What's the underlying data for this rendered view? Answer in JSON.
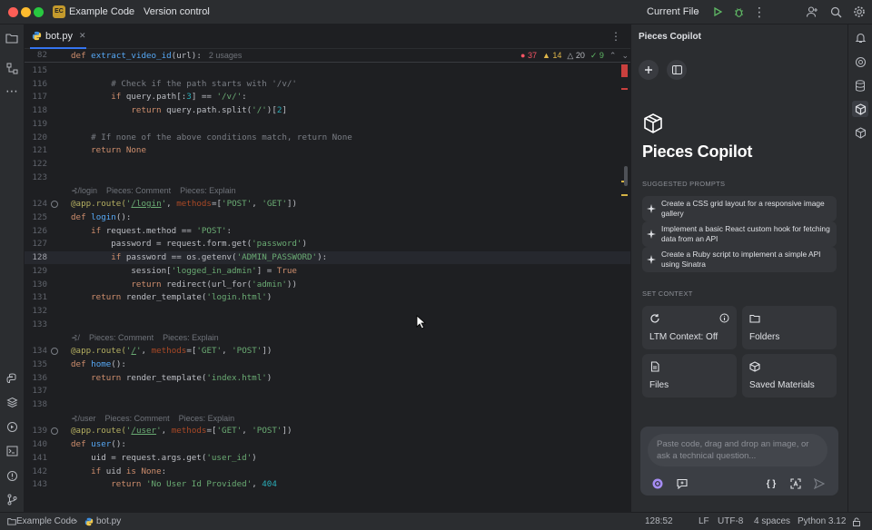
{
  "titlebar": {
    "project_badge": "EC",
    "project_name": "Example Code",
    "vcs_label": "Version control",
    "run_config": "Current File"
  },
  "editor": {
    "tab_name": "bot.py",
    "sticky_line_number": "82",
    "sticky_def": "def",
    "sticky_fn": "extract_video_id",
    "sticky_args": "(url):",
    "sticky_usages": "2 usages",
    "inspections": {
      "errors": "37",
      "warnings": "14",
      "weak": "20",
      "ok": "9"
    },
    "lines": [
      {
        "n": "115",
        "html": ""
      },
      {
        "n": "116",
        "html": "        <span class='cm'># Check if the path starts with '/v/'</span>"
      },
      {
        "n": "117",
        "html": "        <span class='kw'>if</span> query.path[:<span class='num'>3</span>] == <span class='str'>'/v/'</span>:"
      },
      {
        "n": "118",
        "html": "            <span class='kw'>return</span> query.path.split(<span class='str'>'/'</span>)[<span class='num'>2</span>]"
      },
      {
        "n": "119",
        "html": ""
      },
      {
        "n": "120",
        "html": "    <span class='cm'># If none of the above conditions match, return None</span>"
      },
      {
        "n": "121",
        "html": "    <span class='kw'>return None</span>"
      },
      {
        "n": "122",
        "html": ""
      },
      {
        "n": "123",
        "html": ""
      },
      {
        "hint": "⊰/login    Pieces: Comment    Pieces: Explain"
      },
      {
        "n": "124",
        "icon": true,
        "html": "<span class='dec'>@app.route(</span><span class='str'>'<u>/login</u>'</span>, <span class='prm'>methods</span>=[<span class='str'>'POST'</span>, <span class='str'>'GET'</span>])"
      },
      {
        "n": "125",
        "html": "<span class='kw'>def</span> <span class='fn'>login</span>():"
      },
      {
        "n": "126",
        "html": "    <span class='kw'>if</span> request.method == <span class='str'>'POST'</span>:"
      },
      {
        "n": "127",
        "html": "        password = request.form.get(<span class='str'>'password'</span>)"
      },
      {
        "n": "128",
        "current": true,
        "html": "        <span class='kw'>if</span> password == os.getenv(<span class='str'>'ADMIN_PASSWORD'</span>):"
      },
      {
        "n": "129",
        "html": "            session[<span class='str'>'logged_in_admin'</span>] = <span class='kw'>True</span>"
      },
      {
        "n": "130",
        "html": "            <span class='kw'>return</span> redirect(url_for(<span class='str'>'admin'</span>))"
      },
      {
        "n": "131",
        "html": "    <span class='kw'>return</span> render_template(<span class='str'>'login.html'</span>)"
      },
      {
        "n": "132",
        "html": ""
      },
      {
        "n": "133",
        "html": ""
      },
      {
        "hint": "⊰/    Pieces: Comment    Pieces: Explain"
      },
      {
        "n": "134",
        "icon": true,
        "html": "<span class='dec'>@app.route(</span><span class='str'>'<u>/</u>'</span>, <span class='prm'>methods</span>=[<span class='str'>'GET'</span>, <span class='str'>'POST'</span>])"
      },
      {
        "n": "135",
        "html": "<span class='kw'>def</span> <span class='fn'>home</span>():"
      },
      {
        "n": "136",
        "html": "    <span class='kw'>return</span> render_template(<span class='str'>'index.html'</span>)"
      },
      {
        "n": "137",
        "html": ""
      },
      {
        "n": "138",
        "html": ""
      },
      {
        "hint": "⊰/user    Pieces: Comment    Pieces: Explain"
      },
      {
        "n": "139",
        "icon": true,
        "html": "<span class='dec'>@app.route(</span><span class='str'>'<u>/user</u>'</span>, <span class='prm'>methods</span>=[<span class='str'>'GET'</span>, <span class='str'>'POST'</span>])"
      },
      {
        "n": "140",
        "html": "<span class='kw'>def</span> <span class='fn'>user</span>():"
      },
      {
        "n": "141",
        "html": "    uid = request.args.get(<span class='str'>'user_id'</span>)"
      },
      {
        "n": "142",
        "html": "    <span class='kw'>if</span> uid <span class='kw'>is None</span>:"
      },
      {
        "n": "143",
        "html": "        <span class='kw'>return</span> <span class='str'>'No User Id Provided'</span>, <span class='num'>404</span>"
      }
    ]
  },
  "copilot": {
    "panel_title": "Pieces Copilot",
    "hero_title": "Pieces Copilot",
    "suggested_label": "SUGGESTED PROMPTS",
    "prompts": [
      "Create a CSS grid layout for a responsive image gallery",
      "Implement a basic React custom hook for fetching data from an API",
      "Create a Ruby script to implement a simple API using Sinatra"
    ],
    "context_label": "SET CONTEXT",
    "context": {
      "ltm": "LTM Context: Off",
      "folders": "Folders",
      "files": "Files",
      "materials": "Saved Materials"
    },
    "input_placeholder": "Paste code, drag and drop an image, or ask a technical question..."
  },
  "statusbar": {
    "project": "Example Code",
    "file": "bot.py",
    "position": "128:52",
    "line_sep": "LF",
    "encoding": "UTF-8",
    "indent": "4 spaces",
    "interpreter": "Python 3.12"
  },
  "colors": {
    "accent": "#3574f0",
    "run": "#5fb865",
    "error": "#f75464"
  }
}
